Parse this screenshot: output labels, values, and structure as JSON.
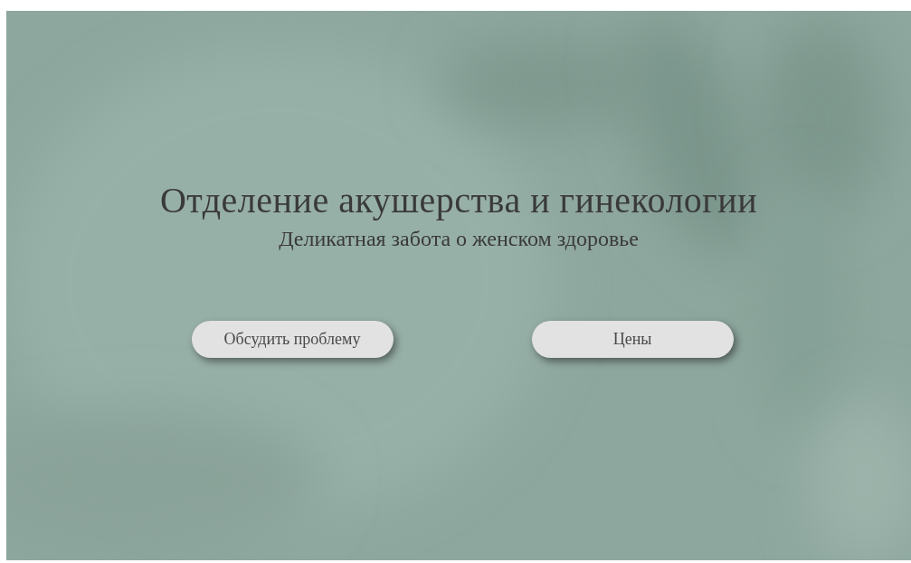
{
  "hero": {
    "title": "Отделение акушерства и гинекологии",
    "subtitle": "Деликатная забота о женском здоровье",
    "buttons": [
      "Обсудить проблему",
      "Цены"
    ]
  }
}
